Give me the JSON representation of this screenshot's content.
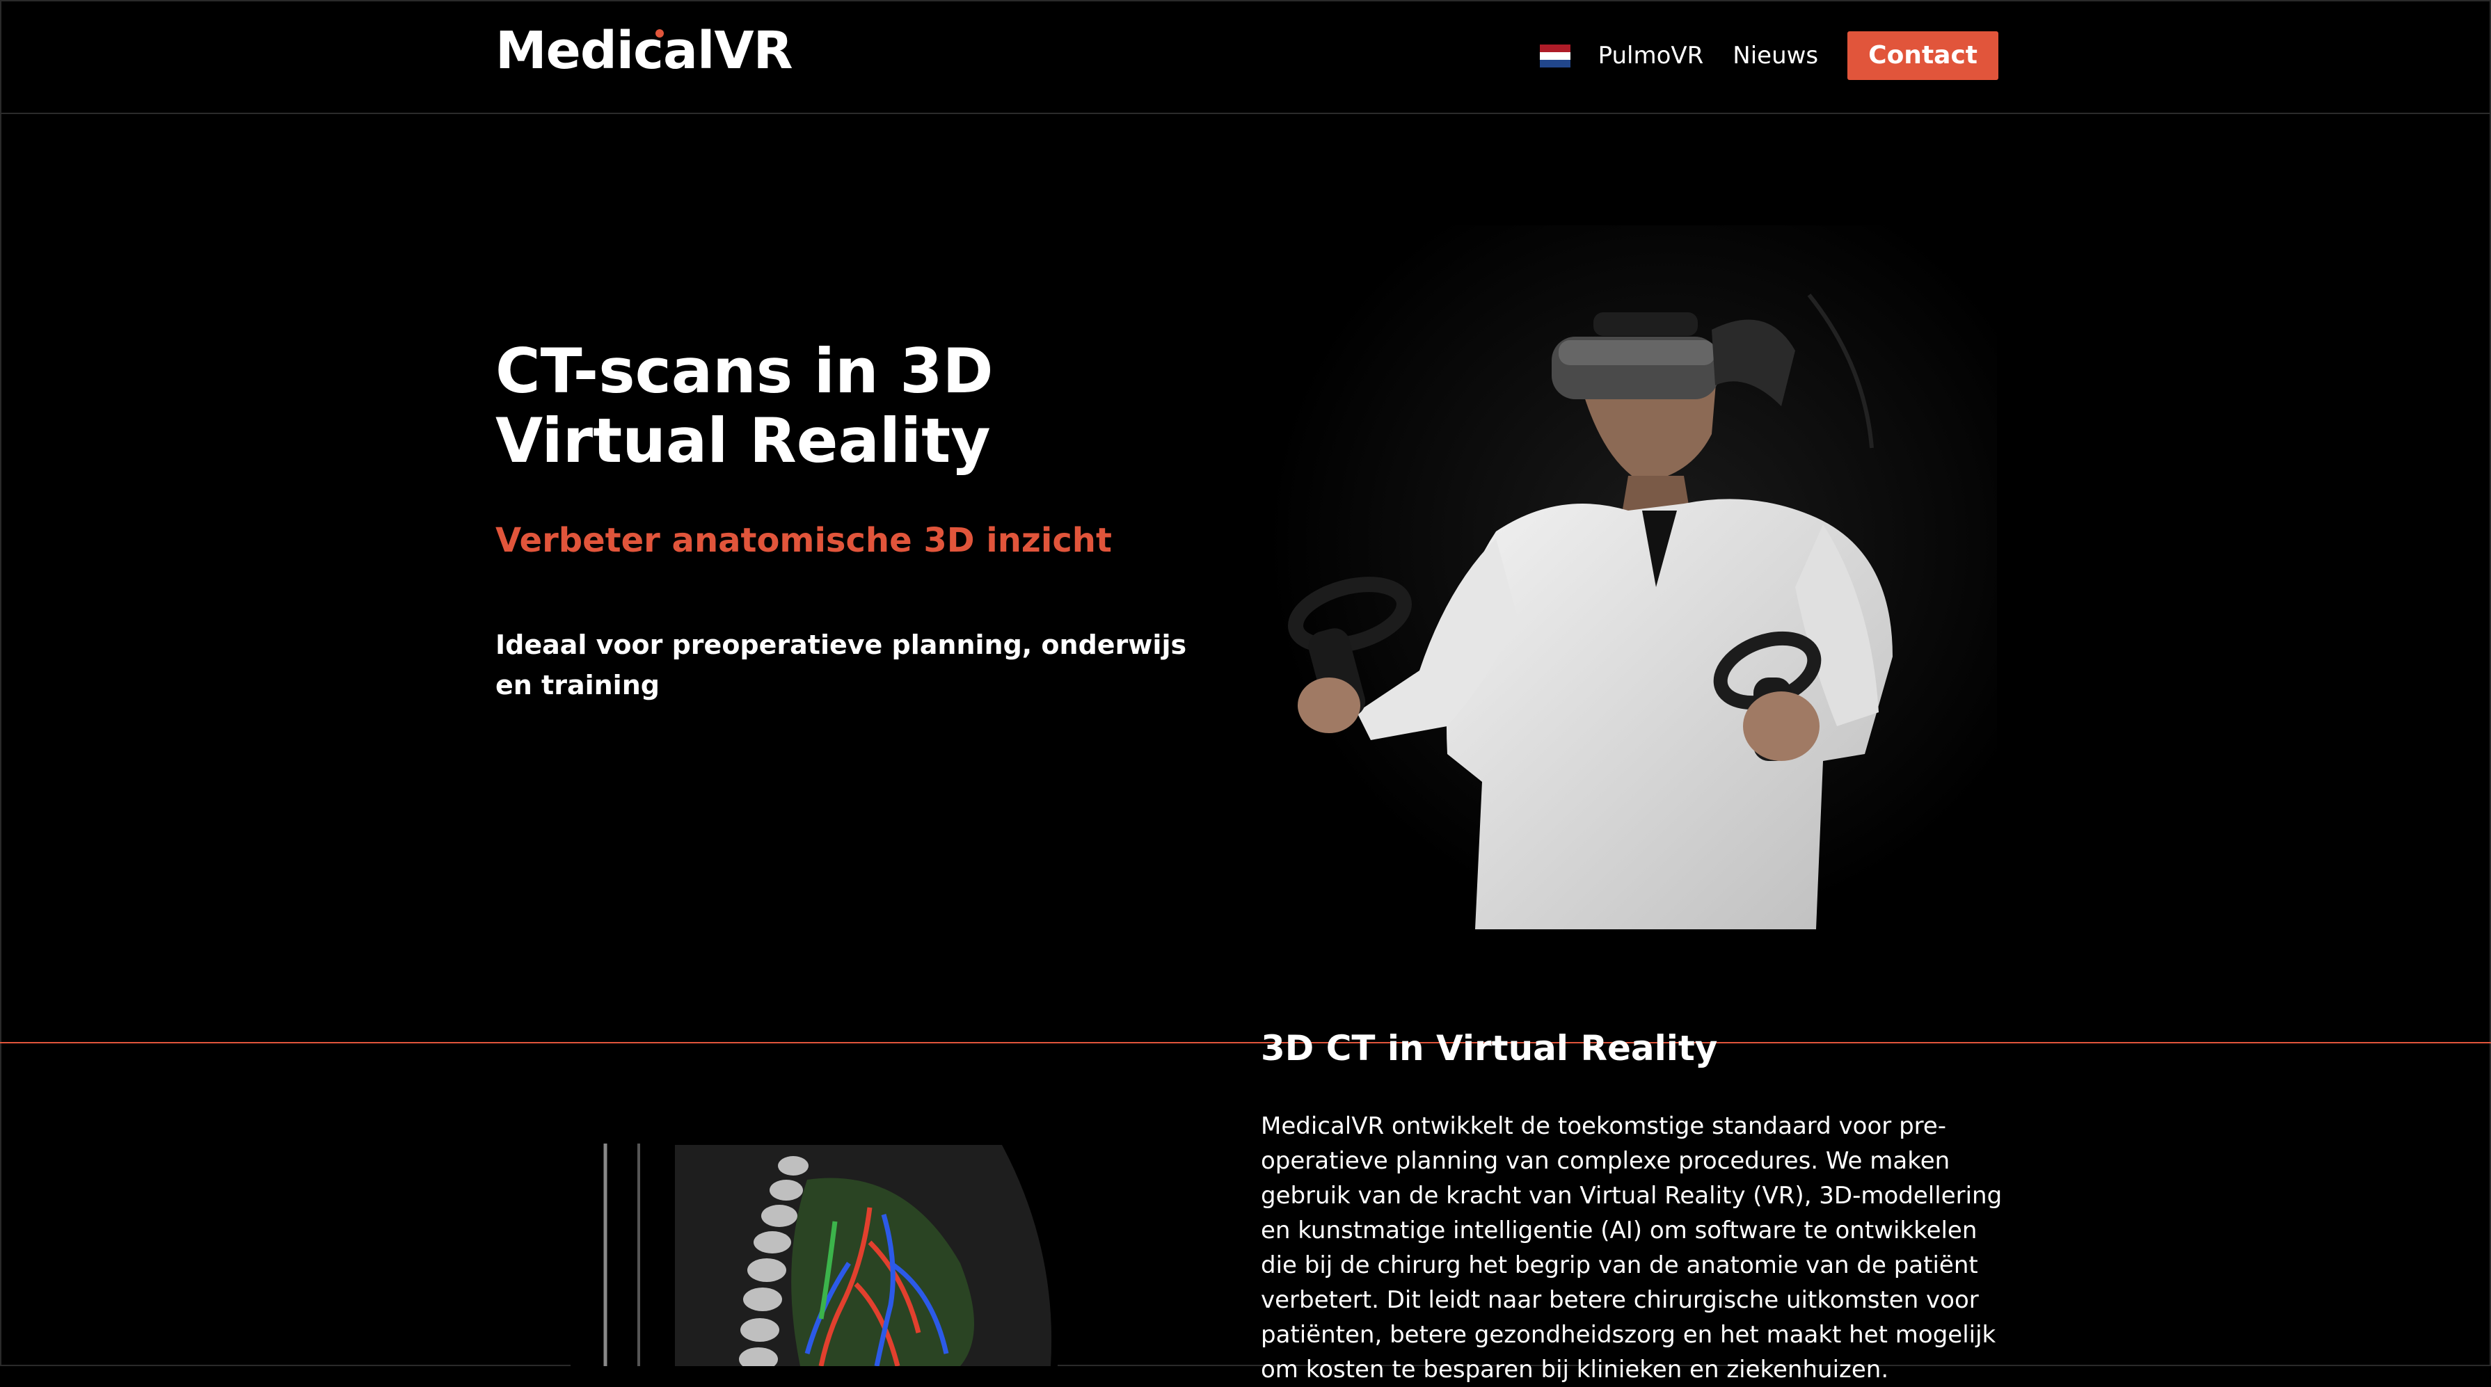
{
  "header": {
    "logo": "MedicalVR",
    "nav": {
      "language_flag": "netherlands-flag-icon",
      "items": [
        {
          "label": "PulmoVR"
        },
        {
          "label": "Nieuws"
        }
      ],
      "contact_label": "Contact"
    }
  },
  "hero": {
    "title": "CT-scans in 3D Virtual Reality",
    "subtitle": "Verbeter anatomische 3D inzicht",
    "text": "Ideaal voor preoperatieve planning, onderwijs en training",
    "image_icon": "vr-headset-surgeon-photo"
  },
  "section": {
    "title": "3D CT in Virtual Reality",
    "body": "MedicalVR ontwikkelt de toekomstige standaard voor pre-operatieve planning van complexe procedures. We maken gebruik van de kracht van Virtual Reality (VR), 3D-modellering en kunstmatige intelligentie (AI) om software te ontwikkelen die bij de chirurg het begrip van de anatomie van de patiënt verbetert. Dit leidt naar betere chirurgische uitkomsten voor patiënten, betere gezondheidszorg en het maakt het mogelijk om kosten te besparen bij klinieken en ziekenhuizen.",
    "image_icon": "ct-lung-3d-render"
  },
  "colors": {
    "accent": "#e1553b",
    "background": "#000000",
    "text": "#ffffff",
    "flag": [
      "#ae1c28",
      "#ffffff",
      "#21468b"
    ]
  }
}
